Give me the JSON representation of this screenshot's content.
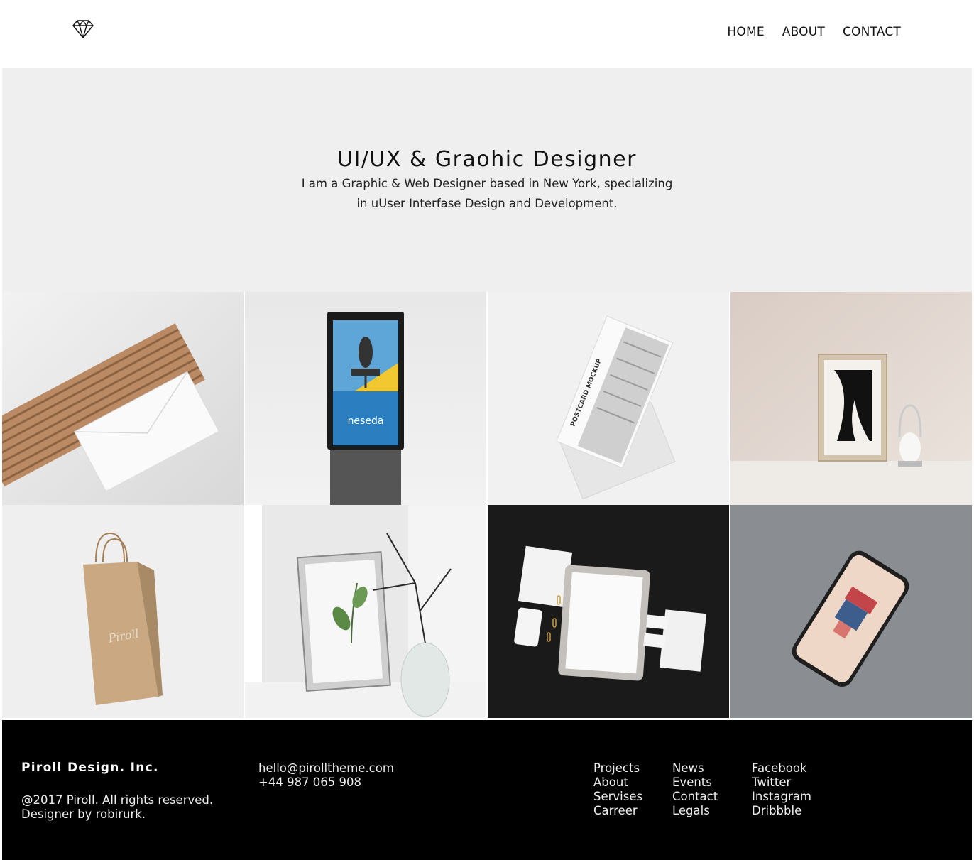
{
  "header": {
    "logo_icon": "diamond-icon",
    "nav": [
      {
        "label": "HOME"
      },
      {
        "label": "ABOUT"
      },
      {
        "label": "CONTACT"
      }
    ]
  },
  "hero": {
    "title": "UI/UX & Graohic Designer",
    "subtitle_line1": "I am a Graphic & Web Designer based in New York, specializing",
    "subtitle_line2": "in uUser Interfase Design and Development."
  },
  "gallery": {
    "items": [
      {
        "name": "envelope-mockup",
        "bg": "#e6e6e6"
      },
      {
        "name": "billboard-mockup",
        "bg": "#e4e4e4",
        "text": "neseda"
      },
      {
        "name": "postcard-mockup",
        "bg": "#f1f1f1",
        "text": "POSTCARD MOCKUP"
      },
      {
        "name": "frame-mockup",
        "bg": "#e2d8d2"
      },
      {
        "name": "bag-mockup",
        "bg": "#efefef"
      },
      {
        "name": "plant-frame-mockup",
        "bg": "#dcdcdc"
      },
      {
        "name": "stationery-mockup",
        "bg": "#1a1a1a"
      },
      {
        "name": "phone-mockup",
        "bg": "#8a8e92"
      }
    ]
  },
  "footer": {
    "brand": "Piroll Design. Inc.",
    "copyright": "@2017 Piroll. All rights reserved.",
    "designer": "Designer by robirurk.",
    "email": "hello@pirolltheme.com",
    "phone": "+44 987 065 908",
    "links_col1": [
      "Projects",
      "About",
      "Servises",
      "Carreer"
    ],
    "links_col2": [
      "News",
      "Events",
      "Contact",
      "Legals"
    ],
    "links_col3": [
      "Facebook",
      "Twitter",
      "Instagram",
      "Dribbble"
    ]
  },
  "colors": {
    "hero_bg": "#efefef",
    "footer_bg": "#000000",
    "text": "#111111"
  }
}
